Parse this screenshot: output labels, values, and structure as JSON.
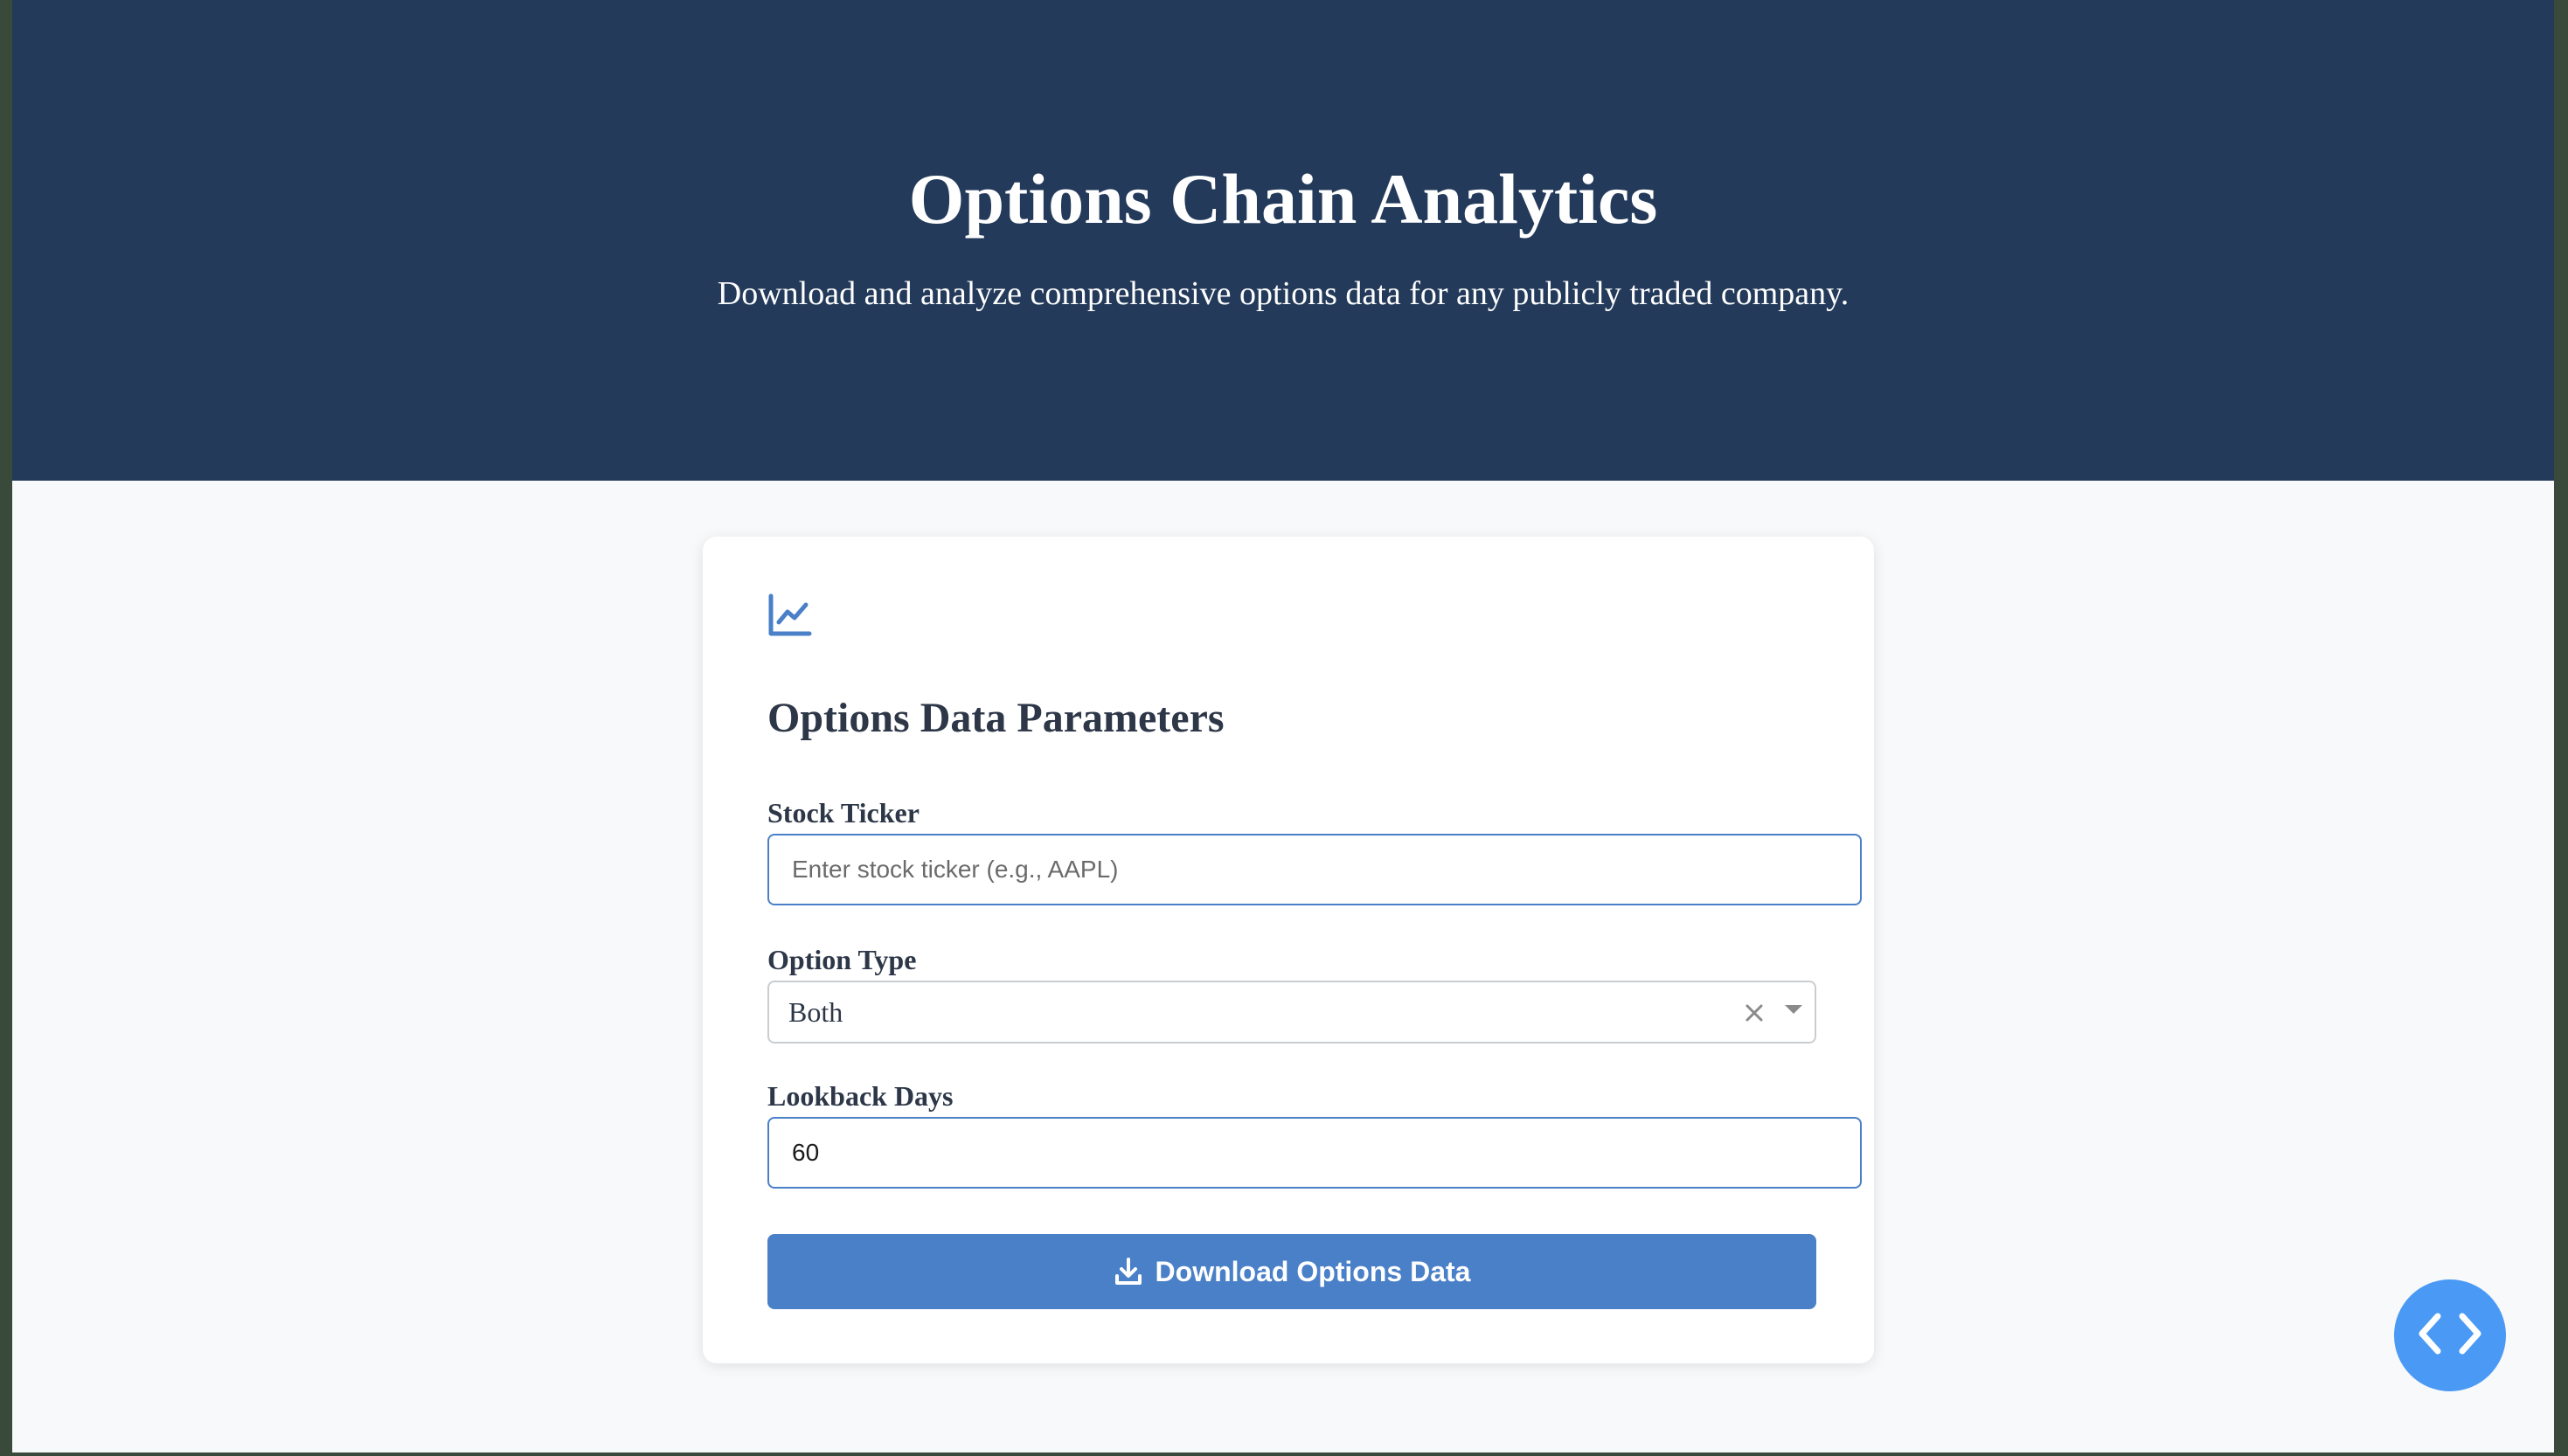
{
  "hero": {
    "title": "Options Chain Analytics",
    "subtitle": "Download and analyze comprehensive options data for any publicly traded company.",
    "background_color": "#233a5a"
  },
  "form": {
    "icon": "line-chart-icon",
    "section_title": "Options Data Parameters",
    "ticker": {
      "label": "Stock Ticker",
      "placeholder": "Enter stock ticker (e.g., AAPL)",
      "value": ""
    },
    "option_type": {
      "label": "Option Type",
      "selected": "Both",
      "clear_icon": "close-icon",
      "dropdown_icon": "caret-down-icon"
    },
    "lookback": {
      "label": "Lookback Days",
      "value": "60"
    },
    "submit": {
      "label": "Download Options Data",
      "icon": "download-icon",
      "color": "#4a80c8"
    }
  },
  "fab": {
    "icon": "code-icon",
    "color": "#4a9af5"
  }
}
